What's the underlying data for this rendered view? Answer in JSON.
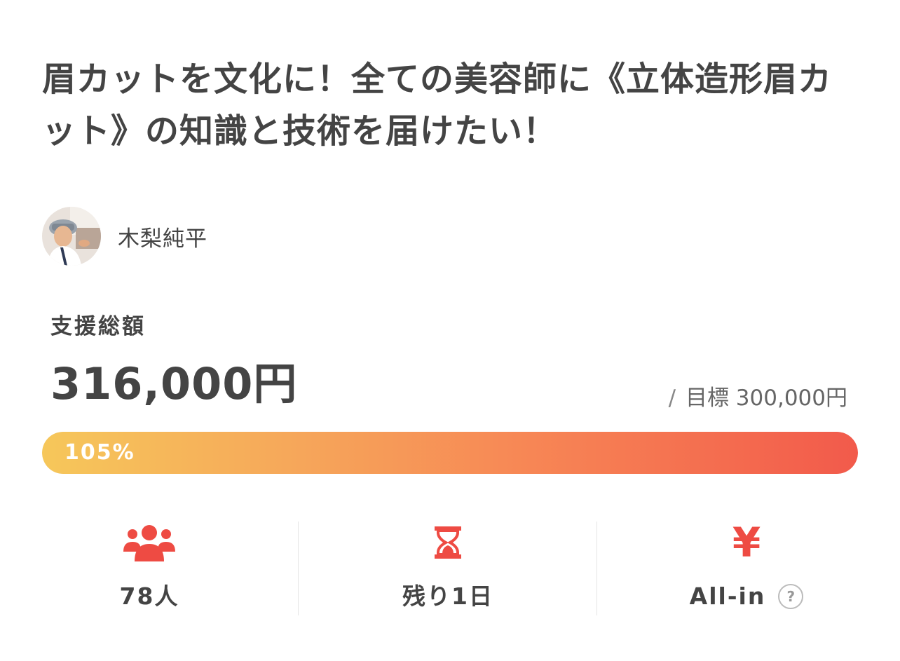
{
  "project": {
    "title": "眉カットを文化に！全ての美容師に《立体造形眉カット》の知識と技術を届けたい！"
  },
  "owner": {
    "name": "木梨純平",
    "avatar_icon": "avatar-photo"
  },
  "funding": {
    "total_label": "支援総額",
    "amount": "316,000円",
    "goal_slash": "/",
    "goal_label": "目標 300,000円",
    "progress_text": "105%",
    "progress_fraction": 1.05
  },
  "stats": {
    "supporters": {
      "icon": "people-icon",
      "value": "78人"
    },
    "remaining": {
      "icon": "hourglass-icon",
      "value": "残り1日"
    },
    "type": {
      "icon": "yen-icon",
      "value": "All-in",
      "help": "?"
    }
  },
  "colors": {
    "accent": "#ee4b43",
    "progress_start": "#f6c75a",
    "progress_end": "#f25a4b",
    "text": "#444444"
  }
}
